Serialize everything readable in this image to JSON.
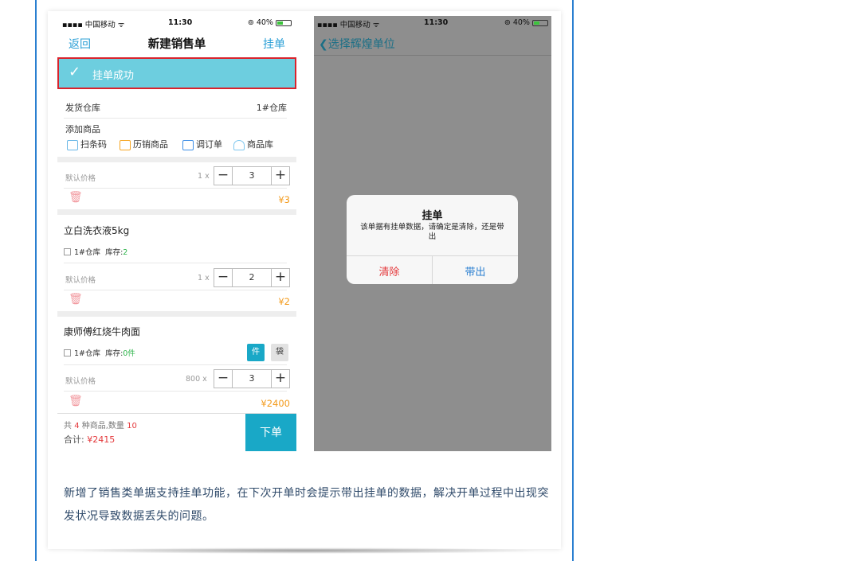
{
  "colors": {
    "accent": "#19a8c7",
    "toast_bg": "#6dcedf",
    "highlight_border": "#d9232c",
    "price": "#f39a1a",
    "frame_border": "#2a7fd0"
  },
  "left_phone": {
    "status": {
      "carrier": "▪▪▪▪ 中国移动 ᯤ",
      "time": "11:30",
      "battery": "⊚ 40%"
    },
    "nav": {
      "back": "返回",
      "title": "新建销售单",
      "right": "挂单"
    },
    "toast": {
      "icon": "check-icon",
      "text": "挂单成功"
    },
    "warehouse": {
      "label": "发货仓库",
      "value": "1#仓库"
    },
    "add_goods": {
      "label": "添加商品",
      "tools": [
        {
          "icon": "barcode-icon",
          "label": "扫条码"
        },
        {
          "icon": "history-icon",
          "label": "历销商品"
        },
        {
          "icon": "order-icon",
          "label": "调订单"
        },
        {
          "icon": "catalog-icon",
          "label": "商品库"
        }
      ]
    },
    "items": [
      {
        "price_label": "默认价格",
        "unit_price": "1 x",
        "qty": "3",
        "total": "¥3"
      },
      {
        "name": "立白洗衣液5kg",
        "warehouse": "1#仓库",
        "stock_label": "库存:",
        "stock_value": "2",
        "price_label": "默认价格",
        "unit_price": "1 x",
        "qty": "2",
        "total": "¥2"
      },
      {
        "name": "康师傅红烧牛肉面",
        "warehouse": "1#仓库",
        "stock_label": "库存:",
        "stock_value": "0件",
        "unit_a": "件",
        "unit_b": "袋",
        "price_label": "默认价格",
        "unit_price": "800 x",
        "qty": "3",
        "total": "¥2400"
      }
    ],
    "footer": {
      "kinds_prefix": "共",
      "kinds": "4",
      "kinds_mid": "种商品,数量",
      "count": "10",
      "total_label": "合计:",
      "total": "¥2415",
      "submit": "下单"
    }
  },
  "right_phone": {
    "status": {
      "carrier": "▪▪▪▪ 中国移动 ᯤ",
      "time": "11:30",
      "battery": "⊚ 40%"
    },
    "nav": {
      "back": "选择辉煌单位"
    },
    "dialog": {
      "title": "挂单",
      "message": "该单据有挂单数据，请确定是清除，还是带出",
      "clear": "清除",
      "take_out": "带出"
    }
  },
  "caption": "新增了销售类单据支持挂单功能，在下次开单时会提示带出挂单的数据，解决开单过程中出现突发状况导致数据丢失的问题。"
}
